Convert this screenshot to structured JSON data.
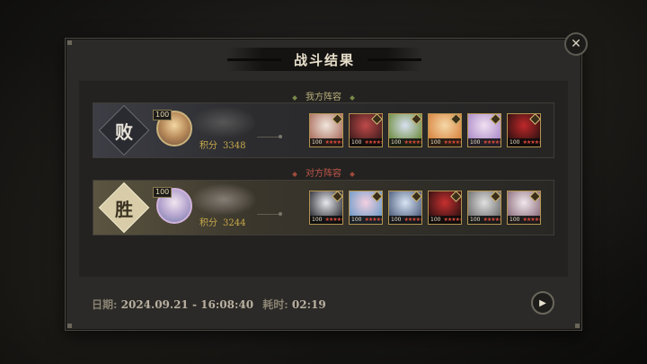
{
  "dialog": {
    "title": "战斗结果",
    "close_icon": "close-icon"
  },
  "our_team": {
    "section_label": "我方阵容",
    "result": "败",
    "leader_level": "100",
    "score_label": "积分",
    "score": "3348",
    "heroes": [
      {
        "level": "100",
        "stars": "★★★★★★",
        "colors": [
          "#f0e6dc",
          "#a86a5a"
        ]
      },
      {
        "level": "100",
        "stars": "★★★★★★",
        "colors": [
          "#c04a4a",
          "#3a1a1a"
        ]
      },
      {
        "level": "100",
        "stars": "★★★★★★",
        "colors": [
          "#d8e0f0",
          "#6a8a3a"
        ]
      },
      {
        "level": "100",
        "stars": "★★★★★★",
        "colors": [
          "#f4d8a8",
          "#d8803a"
        ]
      },
      {
        "level": "100",
        "stars": "★★★★★★",
        "colors": [
          "#f0e0f0",
          "#a888c8"
        ]
      },
      {
        "level": "100",
        "stars": "★★★★★★",
        "colors": [
          "#c0282a",
          "#2a1010"
        ]
      }
    ]
  },
  "enemy_team": {
    "section_label": "对方阵容",
    "result": "胜",
    "leader_level": "100",
    "score_label": "积分",
    "score": "3244",
    "heroes": [
      {
        "level": "100",
        "stars": "★★★★★★",
        "colors": [
          "#e8e8ee",
          "#2a2a32"
        ]
      },
      {
        "level": "100",
        "stars": "★★★★★★",
        "colors": [
          "#f4d0e0",
          "#6a9ac8"
        ]
      },
      {
        "level": "100",
        "stars": "★★★★★★",
        "colors": [
          "#d8e4f4",
          "#4a5a7a"
        ]
      },
      {
        "level": "100",
        "stars": "★★★★★★",
        "colors": [
          "#c83030",
          "#2a1010"
        ]
      },
      {
        "level": "100",
        "stars": "★★★★★★",
        "colors": [
          "#e0e0e0",
          "#6a6a6a"
        ]
      },
      {
        "level": "100",
        "stars": "★★★★★★",
        "colors": [
          "#f0e8ec",
          "#8a6a7a"
        ]
      }
    ]
  },
  "footer": {
    "date_label": "日期:",
    "date_value": "2024.09.21 - 16:08:40",
    "duration_label": "耗时:",
    "duration_value": "02:19",
    "replay_icon": "play-icon"
  }
}
